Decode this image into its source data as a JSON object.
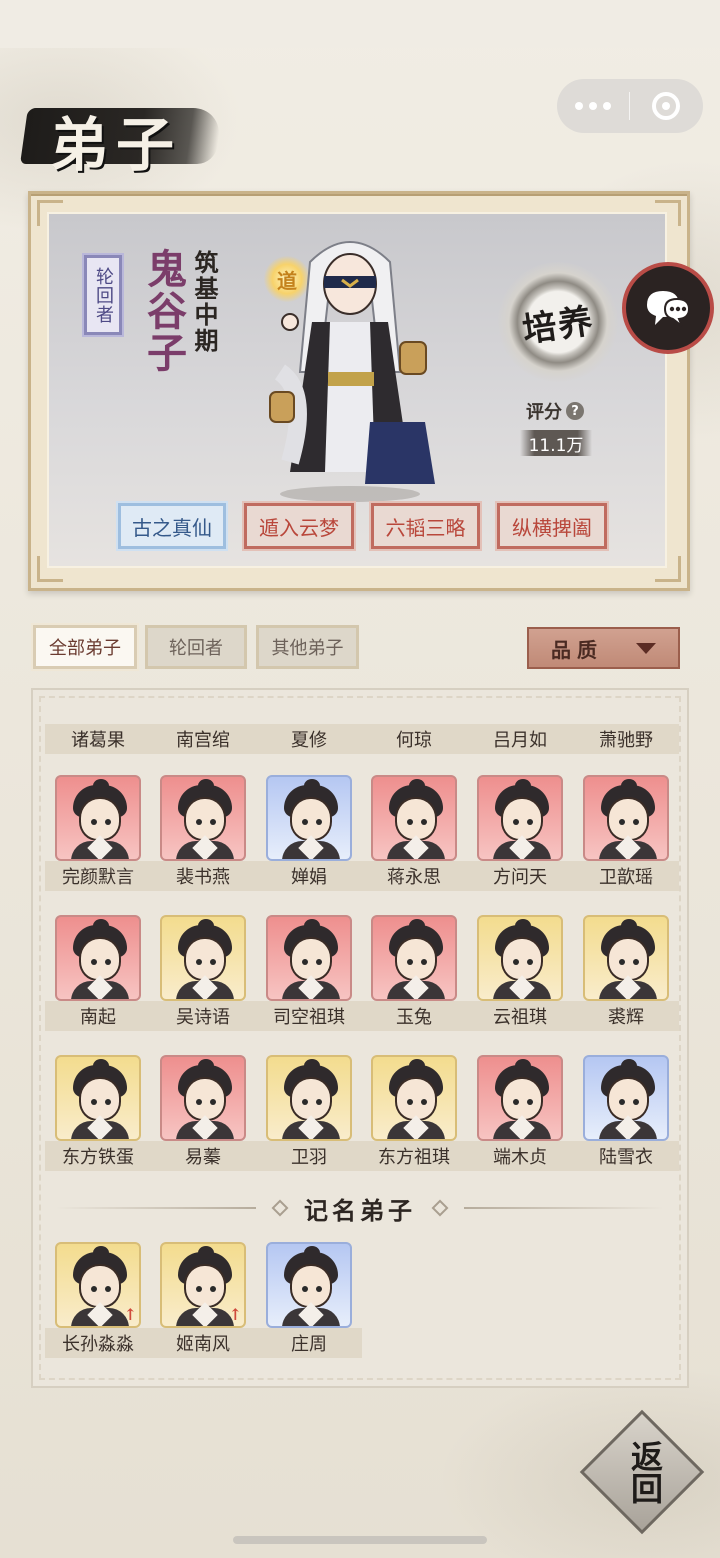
{
  "page": {
    "title": "弟子"
  },
  "capsule": {
    "more_icon": "more-dots-icon",
    "close_icon": "target-close-icon"
  },
  "hero": {
    "tag": "轮回者",
    "name": "鬼谷子",
    "stage": "筑基中期",
    "badge": "道",
    "cultivate": "培养",
    "score_label": "评分",
    "score_help": "?",
    "score_value": "11.1万",
    "skills": [
      "古之真仙",
      "遁入云梦",
      "六韬三略",
      "纵横捭阖"
    ]
  },
  "filters": {
    "tabs": [
      "全部弟子",
      "轮回者",
      "其他弟子"
    ],
    "quality": "品质"
  },
  "roster": {
    "top_names": [
      "诸葛果",
      "南宫绾",
      "夏修",
      "何琼",
      "吕月如",
      "萧驰野"
    ],
    "rows": [
      [
        {
          "name": "完颜默言",
          "color": "red"
        },
        {
          "name": "裴书燕",
          "color": "red"
        },
        {
          "name": "婵娟",
          "color": "blue"
        },
        {
          "name": "蒋永思",
          "color": "red"
        },
        {
          "name": "方问天",
          "color": "red"
        },
        {
          "name": "卫歆瑶",
          "color": "red"
        }
      ],
      [
        {
          "name": "南起",
          "color": "red"
        },
        {
          "name": "吴诗语",
          "color": "yellow"
        },
        {
          "name": "司空祖琪",
          "color": "red"
        },
        {
          "name": "玉兔",
          "color": "red"
        },
        {
          "name": "云祖琪",
          "color": "yellow"
        },
        {
          "name": "裘辉",
          "color": "yellow"
        }
      ],
      [
        {
          "name": "东方铁蛋",
          "color": "yellow"
        },
        {
          "name": "易蓁",
          "color": "red"
        },
        {
          "name": "卫羽",
          "color": "yellow"
        },
        {
          "name": "东方祖琪",
          "color": "yellow"
        },
        {
          "name": "端木贞",
          "color": "red"
        },
        {
          "name": "陆雪衣",
          "color": "blue"
        }
      ]
    ],
    "section_title": "记名弟子",
    "registered": [
      {
        "name": "长孙淼淼",
        "color": "yellow"
      },
      {
        "name": "姬南风",
        "color": "yellow"
      },
      {
        "name": "庄周",
        "color": "blue"
      }
    ]
  },
  "return_label": "返回"
}
